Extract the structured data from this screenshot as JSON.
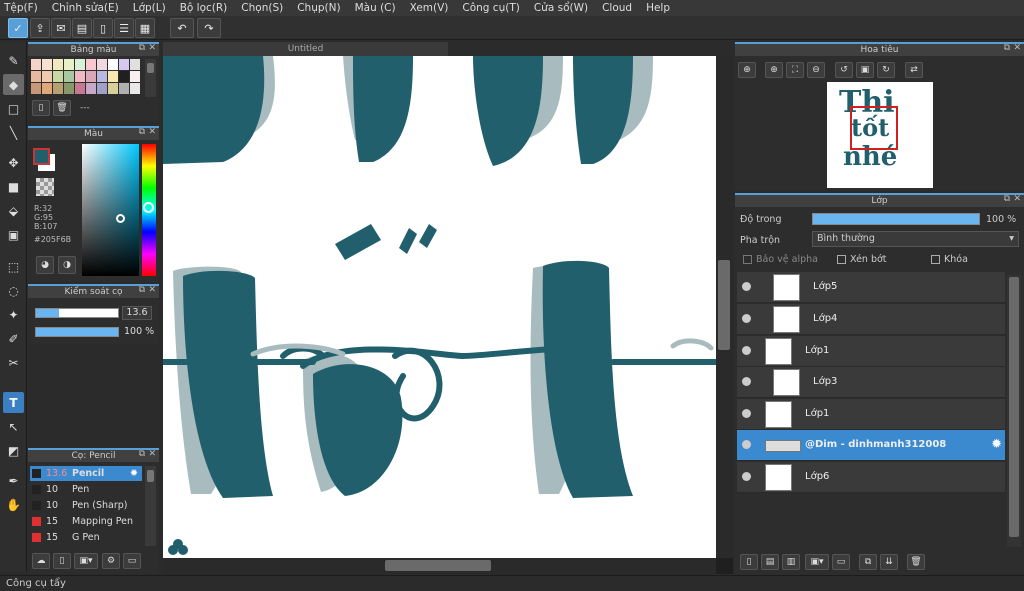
{
  "menu": [
    "Tệp(F)",
    "Chỉnh sửa(E)",
    "Lớp(L)",
    "Bộ lọc(R)",
    "Chọn(S)",
    "Chụp(N)",
    "Màu (C)",
    "Xem(V)",
    "Công cụ(T)",
    "Cửa sổ(W)",
    "Cloud",
    "Help"
  ],
  "canvas": {
    "tab_title": "Untitled"
  },
  "palette_panel": {
    "title": "Bảng màu",
    "name": "---"
  },
  "color_panel": {
    "title": "Màu",
    "r": "R:32",
    "g": "G:95",
    "b": "B:107",
    "hex": "#205F6B",
    "current_color": "#205F6B"
  },
  "brush_control": {
    "title": "Kiểm soát cọ",
    "size": "13.6",
    "opacity": "100 %",
    "size_fraction": 0.28,
    "opacity_fraction": 1.0
  },
  "brush_panel": {
    "title": "Cọ: Pencil",
    "items": [
      {
        "size": "13.6",
        "name": "Pencil",
        "color": "#222222",
        "selected": true
      },
      {
        "size": "10",
        "name": "Pen",
        "color": "#222222"
      },
      {
        "size": "10",
        "name": "Pen (Sharp)",
        "color": "#222222"
      },
      {
        "size": "15",
        "name": "Mapping Pen",
        "color": "#e03030"
      },
      {
        "size": "15",
        "name": "G Pen",
        "color": "#e03030"
      }
    ]
  },
  "navigator": {
    "title": "Hoa tiêu"
  },
  "layers_panel": {
    "title": "Lớp",
    "opacity_label": "Độ trong",
    "opacity_value": "100 %",
    "opacity_fraction": 1.0,
    "blend_label": "Pha trộn",
    "blend_value": "Bình thường",
    "alpha_protect": "Bảo vệ alpha",
    "clipping": "Xén bớt",
    "lock": "Khóa",
    "layers": [
      {
        "name": "Lớp5"
      },
      {
        "name": "Lớp4"
      },
      {
        "name": "Lớp1"
      },
      {
        "name": "Lớp3"
      },
      {
        "name": "Lớp1"
      },
      {
        "name": "@Dim - dinhmanh312008",
        "selected": true
      },
      {
        "name": "Lớp6"
      }
    ]
  },
  "status": {
    "text": "Công cụ tẩy"
  },
  "colors": {
    "accent": "#3b8ad0",
    "teal": "#205F6B",
    "shadow": "#9fb5ba"
  },
  "thumbnail_text": {
    "line1": "Thi",
    "line2": "tốt",
    "line3": "nhé"
  }
}
